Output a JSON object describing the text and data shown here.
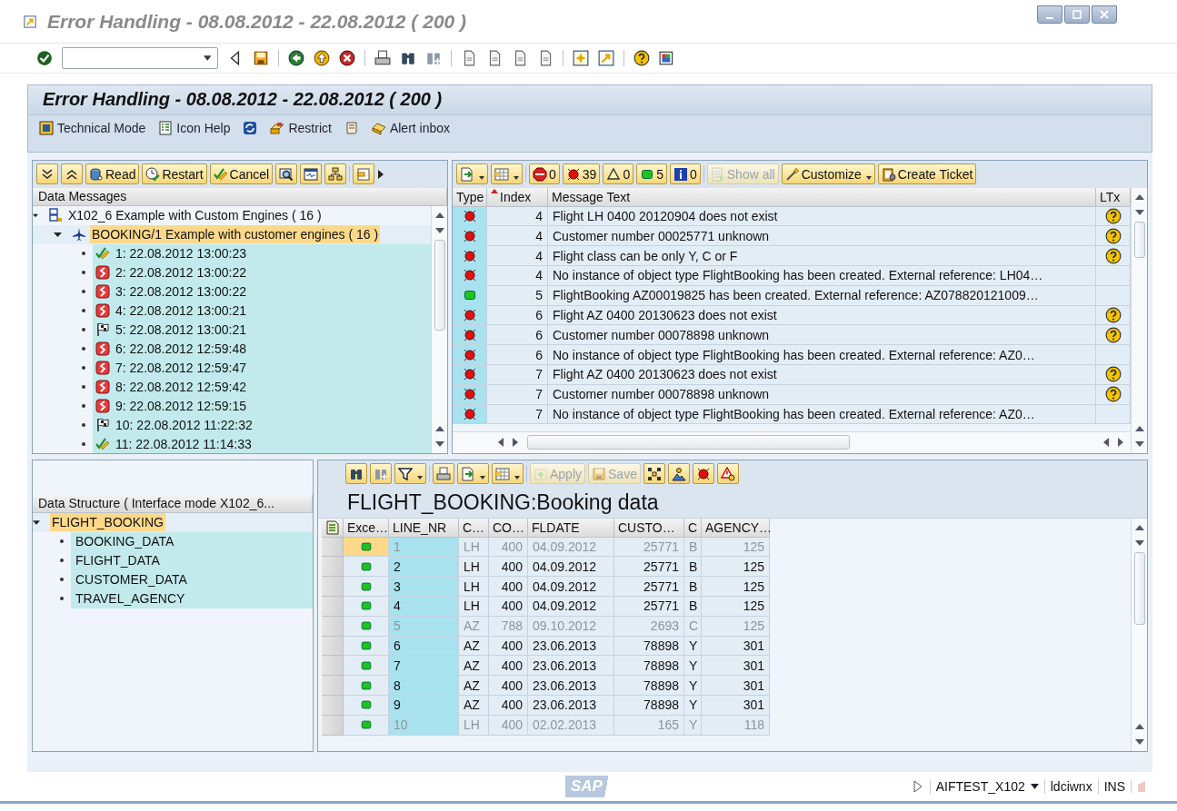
{
  "window": {
    "title": "Error Handling - 08.08.2012 - 22.08.2012 ( 200 )"
  },
  "system_toolbar": [
    {
      "kind": "enter"
    },
    {
      "kind": "command"
    },
    {
      "kind": "prev"
    },
    {
      "kind": "save"
    },
    {
      "kind": "sep"
    },
    {
      "kind": "back"
    },
    {
      "kind": "exit"
    },
    {
      "kind": "cancel"
    },
    {
      "kind": "sep"
    },
    {
      "kind": "print"
    },
    {
      "kind": "find"
    },
    {
      "kind": "findnext"
    },
    {
      "kind": "sep"
    },
    {
      "kind": "page"
    },
    {
      "kind": "page"
    },
    {
      "kind": "page"
    },
    {
      "kind": "page"
    },
    {
      "kind": "sep"
    },
    {
      "kind": "newwin"
    },
    {
      "kind": "shortcut"
    },
    {
      "kind": "sep"
    },
    {
      "kind": "help"
    },
    {
      "kind": "layout"
    }
  ],
  "screen": {
    "title": "Error Handling - 08.08.2012 - 22.08.2012 ( 200 )",
    "actions": [
      {
        "kind": "technical",
        "label": "Technical Mode"
      },
      {
        "kind": "iconhelp",
        "label": "Icon Help"
      },
      {
        "kind": "refresh"
      },
      {
        "kind": "restrict",
        "label": "Restrict"
      },
      {
        "kind": "scroll"
      },
      {
        "kind": "alert",
        "label": "Alert inbox"
      }
    ]
  },
  "data_messages": {
    "toolbar": [
      {
        "kind": "expand"
      },
      {
        "kind": "collapse"
      },
      {
        "kind": "read",
        "label": "Read"
      },
      {
        "kind": "restart",
        "label": "Restart"
      },
      {
        "kind": "checkpencil",
        "label": "Cancel"
      },
      {
        "kind": "inspect"
      },
      {
        "kind": "monitor"
      },
      {
        "kind": "tree"
      },
      {
        "kind": "sep"
      },
      {
        "kind": "more"
      }
    ],
    "header": "Data Messages",
    "nodes": [
      {
        "kind": "interface",
        "label": "X102_6 Example with Custom Engines ( 16  )",
        "expanded": true,
        "selected": false,
        "children": [
          {
            "kind": "flight",
            "label": "BOOKING/1 Example with customer engines ( 16  )",
            "expanded": true,
            "selected": true,
            "children": [
              {
                "kind": "ok",
                "label": "1: 22.08.2012 13:00:23",
                "selected": false
              },
              {
                "kind": "fail",
                "label": "2: 22.08.2012 13:00:22",
                "selected": false
              },
              {
                "kind": "fail",
                "label": "3: 22.08.2012 13:00:22",
                "selected": false
              },
              {
                "kind": "fail",
                "label": "4: 22.08.2012 13:00:21",
                "selected": false
              },
              {
                "kind": "flag",
                "label": "5: 22.08.2012 13:00:21",
                "selected": false
              },
              {
                "kind": "fail",
                "label": "6: 22.08.2012 12:59:48",
                "selected": false
              },
              {
                "kind": "fail",
                "label": "7: 22.08.2012 12:59:47",
                "selected": false
              },
              {
                "kind": "fail",
                "label": "8: 22.08.2012 12:59:42",
                "selected": false
              },
              {
                "kind": "fail",
                "label": "9: 22.08.2012 12:59:15",
                "selected": false
              },
              {
                "kind": "flag",
                "label": "10: 22.08.2012 11:22:32",
                "selected": false
              },
              {
                "kind": "ok",
                "label": "11: 22.08.2012 11:14:33",
                "selected": false
              }
            ]
          }
        ]
      }
    ]
  },
  "messages": {
    "toolbar": [
      {
        "kind": "export",
        "dropdown": true,
        "disabled": false
      },
      {
        "kind": "grid",
        "dropdown": true,
        "disabled": false
      },
      {
        "kind": "sep"
      },
      {
        "kind": "stop",
        "label": "0",
        "dropdown": false,
        "disabled": false
      },
      {
        "kind": "error",
        "label": "39",
        "dropdown": false,
        "disabled": false
      },
      {
        "kind": "warning",
        "label": "0",
        "dropdown": false,
        "disabled": false
      },
      {
        "kind": "success",
        "label": "5",
        "dropdown": false,
        "disabled": false
      },
      {
        "kind": "info",
        "label": "0",
        "dropdown": false,
        "disabled": false
      },
      {
        "kind": "sep"
      },
      {
        "kind": "showall",
        "label": "Show all",
        "dropdown": false,
        "disabled": true
      },
      {
        "kind": "customize",
        "label": "Customize",
        "dropdown": true,
        "disabled": false
      },
      {
        "kind": "ticket",
        "label": "Create Ticket",
        "dropdown": false,
        "disabled": false
      }
    ],
    "columns": [
      {
        "label": "Type",
        "sorted": false
      },
      {
        "label": "Index",
        "sorted": true
      },
      {
        "label": "Message Text",
        "sorted": false
      },
      {
        "label": "LTx",
        "sorted": false
      }
    ],
    "rows": [
      {
        "kind": "error",
        "index": "4",
        "text": "Flight LH 0400 20120904 does not exist",
        "long_text": true
      },
      {
        "kind": "error",
        "index": "4",
        "text": "Customer number 00025771 unknown",
        "long_text": true
      },
      {
        "kind": "error",
        "index": "4",
        "text": "Flight class can be only Y, C or F",
        "long_text": true
      },
      {
        "kind": "error",
        "index": "4",
        "text": "No instance of object type FlightBooking has been created. External reference: LH04…",
        "long_text": false
      },
      {
        "kind": "success",
        "index": "5",
        "text": "FlightBooking AZ00019825 has been created. External reference: AZ078820121009…",
        "long_text": false
      },
      {
        "kind": "error",
        "index": "6",
        "text": "Flight AZ 0400 20130623 does not exist",
        "long_text": true
      },
      {
        "kind": "error",
        "index": "6",
        "text": "Customer number 00078898 unknown",
        "long_text": true
      },
      {
        "kind": "error",
        "index": "6",
        "text": "No instance of object type FlightBooking has been created. External reference: AZ0…",
        "long_text": false
      },
      {
        "kind": "error",
        "index": "7",
        "text": "Flight AZ 0400 20130623 does not exist",
        "long_text": true
      },
      {
        "kind": "error",
        "index": "7",
        "text": "Customer number 00078898 unknown",
        "long_text": true
      },
      {
        "kind": "error",
        "index": "7",
        "text": "No instance of object type FlightBooking has been created. External reference: AZ0…",
        "long_text": false
      }
    ]
  },
  "data_structure": {
    "header": "Data Structure ( Interface mode X102_6...",
    "nodes": [
      {
        "label": "FLIGHT_BOOKING",
        "expanded": true,
        "selected": true,
        "children": [
          {
            "label": "BOOKING_DATA",
            "selected": false
          },
          {
            "label": "FLIGHT_DATA",
            "selected": false
          },
          {
            "label": "CUSTOMER_DATA",
            "selected": false
          },
          {
            "label": "TRAVEL_AGENCY",
            "selected": false
          }
        ]
      }
    ]
  },
  "booking_data": {
    "toolbar": [
      {
        "kind": "find",
        "dropdown": false,
        "disabled": false
      },
      {
        "kind": "findnext",
        "dropdown": false,
        "disabled": false
      },
      {
        "kind": "filter",
        "dropdown": true,
        "disabled": false
      },
      {
        "kind": "sep"
      },
      {
        "kind": "print",
        "dropdown": false,
        "disabled": false
      },
      {
        "kind": "export",
        "dropdown": true,
        "disabled": false
      },
      {
        "kind": "grid",
        "dropdown": true,
        "disabled": false
      },
      {
        "kind": "sep"
      },
      {
        "kind": "apply",
        "label": "Apply",
        "dropdown": false,
        "disabled": true
      },
      {
        "kind": "save",
        "label": "Save",
        "dropdown": false,
        "disabled": true
      },
      {
        "kind": "pivot",
        "dropdown": false,
        "disabled": false
      },
      {
        "kind": "image",
        "dropdown": false,
        "disabled": false
      },
      {
        "kind": "error",
        "dropdown": false,
        "disabled": false
      },
      {
        "kind": "alarm",
        "dropdown": false,
        "disabled": false
      }
    ],
    "title": "FLIGHT_BOOKING:Booking data",
    "columns": [
      "Exce…",
      "LINE_NR",
      "C…",
      "CO…",
      "FLDATE",
      "CUSTO…",
      "C",
      "AGENCY…"
    ],
    "rows": [
      {
        "kind": "success",
        "cells": [
          "",
          "1",
          "LH",
          "400",
          "04.09.2012",
          "25771",
          "B",
          "125"
        ],
        "dimmed": true,
        "selected": true
      },
      {
        "kind": "success",
        "cells": [
          "",
          "2",
          "LH",
          "400",
          "04.09.2012",
          "25771",
          "B",
          "125"
        ],
        "dimmed": false,
        "selected": false
      },
      {
        "kind": "success",
        "cells": [
          "",
          "3",
          "LH",
          "400",
          "04.09.2012",
          "25771",
          "B",
          "125"
        ],
        "dimmed": false,
        "selected": false
      },
      {
        "kind": "success",
        "cells": [
          "",
          "4",
          "LH",
          "400",
          "04.09.2012",
          "25771",
          "B",
          "125"
        ],
        "dimmed": false,
        "selected": false
      },
      {
        "kind": "success",
        "cells": [
          "",
          "5",
          "AZ",
          "788",
          "09.10.2012",
          "2693",
          "C",
          "125"
        ],
        "dimmed": true,
        "selected": false
      },
      {
        "kind": "success",
        "cells": [
          "",
          "6",
          "AZ",
          "400",
          "23.06.2013",
          "78898",
          "Y",
          "301"
        ],
        "dimmed": false,
        "selected": false
      },
      {
        "kind": "success",
        "cells": [
          "",
          "7",
          "AZ",
          "400",
          "23.06.2013",
          "78898",
          "Y",
          "301"
        ],
        "dimmed": false,
        "selected": false
      },
      {
        "kind": "success",
        "cells": [
          "",
          "8",
          "AZ",
          "400",
          "23.06.2013",
          "78898",
          "Y",
          "301"
        ],
        "dimmed": false,
        "selected": false
      },
      {
        "kind": "success",
        "cells": [
          "",
          "9",
          "AZ",
          "400",
          "23.06.2013",
          "78898",
          "Y",
          "301"
        ],
        "dimmed": false,
        "selected": false
      },
      {
        "kind": "success",
        "cells": [
          "",
          "10",
          "LH",
          "400",
          "02.02.2013",
          "165",
          "Y",
          "118"
        ],
        "dimmed": true,
        "selected": false
      }
    ]
  },
  "status_bar": {
    "logo": "SAP",
    "system": "AIFTEST_X102",
    "client": "ldciwnx",
    "mode": "INS"
  }
}
